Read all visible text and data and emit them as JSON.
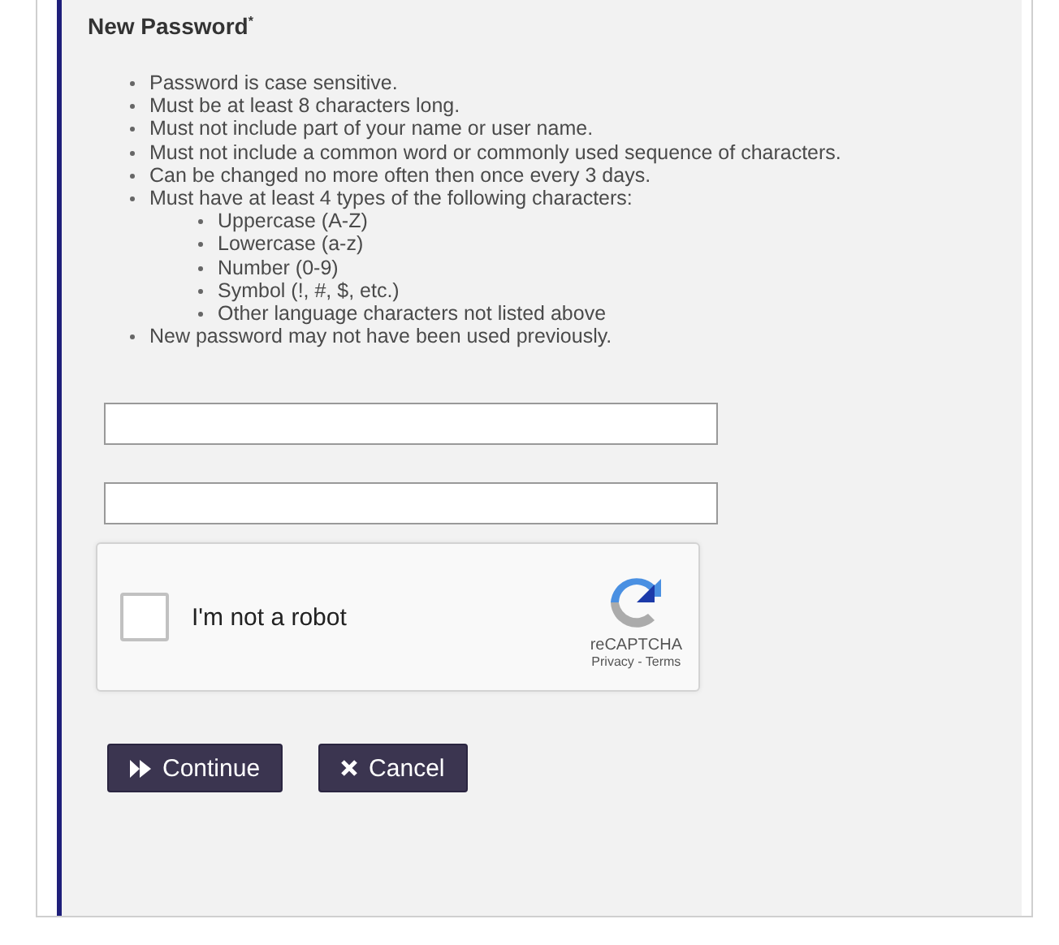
{
  "heading": "New Password$^{*}$",
  "rules": [
    {
      "text": "Password is case sensitive."
    },
    {
      "text": "Must be at least 8 characters long."
    },
    {
      "text": "Must not include part of your name or user name."
    },
    {
      "text": "Must not include a common word or commonly used sequence of characters."
    },
    {
      "text": "Can be changed no more often then once every 3 days."
    },
    {
      "text": "Must have at least 4 types of the following characters:",
      "children": [
        {
          "text": "Uppercase (A-Z)"
        },
        {
          "text": "Lowercase (a-z)"
        },
        {
          "text": "Number (0-9)"
        },
        {
          "text": "Symbol (!, #, $, etc.)"
        },
        {
          "text": "Other language characters not listed above"
        }
      ]
    },
    {
      "text": "New password may not have been used previously."
    }
  ],
  "fields": [
    {
      "kind": "password"
    },
    {
      "kind": "password"
    }
  ],
  "captcha": {
    "checked": false,
    "label": "I'm not a robot",
    "brand": "reCAPTCHA",
    "links": "Privacy - Terms"
  },
  "buttons": [
    {
      "kind": "continue",
      "label": "Continue"
    },
    {
      "kind": "cancel",
      "label": "Cancel"
    }
  ]
}
